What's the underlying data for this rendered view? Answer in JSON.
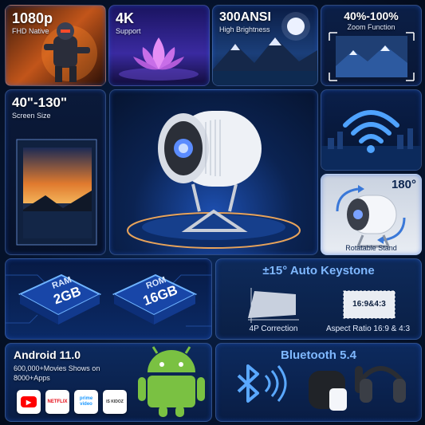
{
  "tiles": {
    "hd": {
      "title": "1080p",
      "subtitle": "FHD Native"
    },
    "k4": {
      "title": "4K",
      "subtitle": "Support"
    },
    "ansi": {
      "title": "300ANSI",
      "subtitle": "High Brightness"
    },
    "zoom": {
      "title": "40%-100%",
      "subtitle": "Zoom Function"
    },
    "screen": {
      "title": "40\"-130\"",
      "subtitle": "Screen Size"
    },
    "rotate": {
      "title": "180°",
      "subtitle": "Rotatable Stand"
    },
    "memory": {
      "ram_label": "RAM",
      "ram_value": "2GB",
      "rom_label": "ROM",
      "rom_value": "16GB"
    },
    "keystone": {
      "title": "±15° Auto Keystone",
      "left_caption": "4P Correction",
      "right_caption": "Aspect Ratio 16:9 & 4:3",
      "ratio_text": "16:9&4:3"
    },
    "android": {
      "title": "Android 11.0",
      "line1": "600,000+Movies Shows on",
      "line2": "8000+Apps"
    },
    "bluetooth": {
      "title": "Bluetooth 5.4"
    }
  },
  "apps": [
    {
      "name": "youtube-icon",
      "label": "▶",
      "color": "#ff0000"
    },
    {
      "name": "netflix-icon",
      "label": "NETFLIX",
      "color": "#e50914"
    },
    {
      "name": "prime-video-icon",
      "label": "prime video",
      "color": "#1a98ff"
    },
    {
      "name": "kidoz-icon",
      "label": "IS KIDOZ",
      "color": "#333333"
    }
  ],
  "colors": {
    "accent": "#3a8bff",
    "title_blue": "#7fb8ff",
    "background": "#05122b"
  }
}
